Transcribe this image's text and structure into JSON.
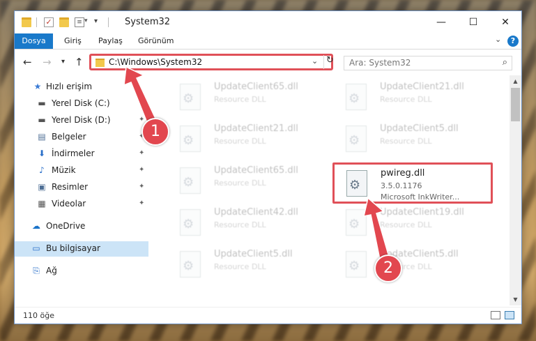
{
  "window": {
    "title": "System32",
    "minimize": "—",
    "maximize": "☐",
    "close": "✕",
    "quick_access_dropdown": "▾"
  },
  "ribbon": {
    "file": "Dosya",
    "tabs": [
      "Giriş",
      "Paylaş",
      "Görünüm"
    ],
    "collapse": "⌄",
    "help": "?"
  },
  "nav": {
    "back": "←",
    "forward": "→",
    "recent": "▾",
    "up": "↑",
    "address": "C:\\Windows\\System32",
    "address_dropdown": "⌄",
    "refresh": "↻",
    "search_placeholder": "Ara: System32",
    "search_icon": "⌕"
  },
  "sidebar": {
    "items": [
      {
        "label": "Hızlı erişim",
        "icon": "star-icon",
        "glyph": "★",
        "color": "#3a7bd5"
      },
      {
        "label": "Yerel Disk (C:)",
        "icon": "drive-icon",
        "glyph": "▬",
        "color": "#555555",
        "pin": "📌"
      },
      {
        "label": "Yerel Disk (D:)",
        "icon": "drive-icon",
        "glyph": "▬",
        "color": "#555555",
        "pin": "📌"
      },
      {
        "label": "Belgeler",
        "icon": "documents-icon",
        "glyph": "▤",
        "color": "#4f6f95",
        "pin": "📌"
      },
      {
        "label": "İndirmeler",
        "icon": "downloads-icon",
        "glyph": "⬇",
        "color": "#2a6fc9",
        "pin": "📌"
      },
      {
        "label": "Müzik",
        "icon": "music-icon",
        "glyph": "♪",
        "color": "#2a6fc9",
        "pin": "📌"
      },
      {
        "label": "Resimler",
        "icon": "pictures-icon",
        "glyph": "▣",
        "color": "#4f6f95",
        "pin": "📌"
      },
      {
        "label": "Videolar",
        "icon": "videos-icon",
        "glyph": "▦",
        "color": "#555555",
        "pin": "📌"
      },
      {
        "label": "OneDrive",
        "icon": "onedrive-icon",
        "glyph": "☁",
        "color": "#1a73c8"
      },
      {
        "label": "Bu bilgisayar",
        "icon": "computer-icon",
        "glyph": "▭",
        "color": "#2a6fc9"
      },
      {
        "label": "Ağ",
        "icon": "network-icon",
        "glyph": "⎘",
        "color": "#2a6fc9"
      }
    ]
  },
  "files": [
    {
      "name": "UpdateClient65.dll",
      "type": "Resource DLL",
      "col": 0,
      "row": 0
    },
    {
      "name": "UpdateClient21.dll",
      "type": "Resource DLL",
      "col": 1,
      "row": 0
    },
    {
      "name": "UpdateClient21.dll",
      "type": "Resource DLL",
      "col": 0,
      "row": 1
    },
    {
      "name": "UpdateClient5.dll",
      "type": "Resource DLL",
      "col": 1,
      "row": 1
    },
    {
      "name": "UpdateClient65.dll",
      "type": "Resource DLL",
      "col": 0,
      "row": 2
    },
    {
      "name": "UpdateClient42.dll",
      "type": "Resource DLL",
      "col": 0,
      "row": 3
    },
    {
      "name": "UpdateClient19.dll",
      "type": "Resource DLL",
      "col": 1,
      "row": 3
    },
    {
      "name": "UpdateClient5.dll",
      "type": "Resource DLL",
      "col": 0,
      "row": 4
    },
    {
      "name": "UpdateClient5.dll",
      "type": "Resource DLL",
      "col": 1,
      "row": 4
    }
  ],
  "highlighted_file": {
    "name": "pwireg.dll",
    "version": "3.5.0.1176",
    "company": "Microsoft InkWriter..."
  },
  "status": {
    "item_count": "110 öğe"
  },
  "annotations": {
    "step1": "1",
    "step2": "2",
    "color": "#e2474f"
  }
}
